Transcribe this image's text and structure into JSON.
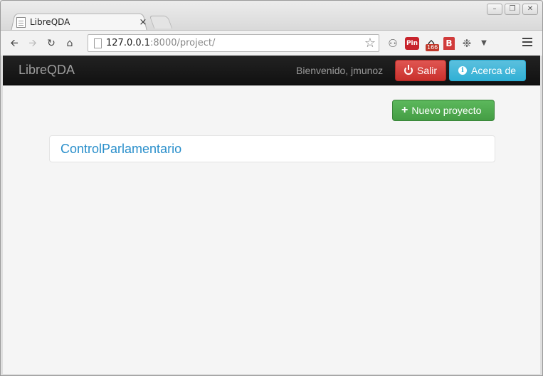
{
  "browser": {
    "tab_title": "LibreQDA",
    "tab_close": "×",
    "url_host": "127.0.0.1",
    "url_rest": ":8000/project/",
    "star": "☆",
    "window_controls": [
      "–",
      "❐",
      "✕"
    ],
    "extensions": {
      "pin_label": "Pin",
      "badge_count": "166",
      "b_label": "B"
    }
  },
  "navbar": {
    "brand": "LibreQDA",
    "welcome": "Bienvenido, jmunoz",
    "logout_label": "Salir",
    "about_label": "Acerca de",
    "colors": {
      "danger": "#d9534f",
      "info": "#5bc0de",
      "success": "#5cb85c",
      "navbar_bg": "#1b1b1b"
    }
  },
  "main": {
    "new_project_label": "Nuevo proyecto",
    "projects": [
      "ControlParlamentario"
    ]
  }
}
